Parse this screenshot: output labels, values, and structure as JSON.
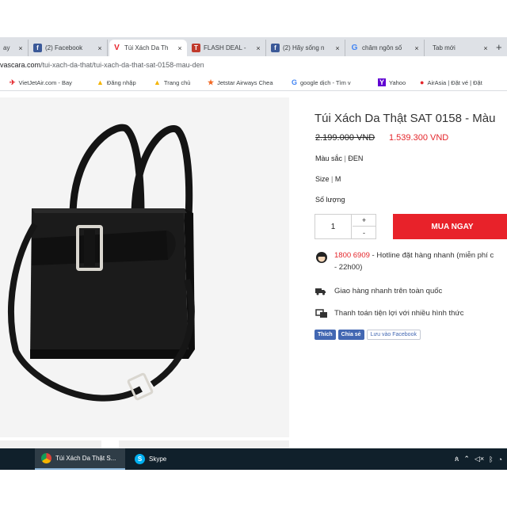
{
  "browser": {
    "tabs": [
      {
        "title": "ay",
        "icon": "page-icon",
        "active": false
      },
      {
        "title": "(2) Facebook",
        "icon": "facebook-icon",
        "active": false
      },
      {
        "title": "Túi Xách Da Th",
        "icon": "vascara-icon",
        "active": true
      },
      {
        "title": "FLASH DEAL -",
        "icon": "flash-deal-icon",
        "active": false
      },
      {
        "title": "(2) Hãy sống n",
        "icon": "facebook-icon",
        "active": false
      },
      {
        "title": "châm ngôn số",
        "icon": "google-icon",
        "active": false
      },
      {
        "title": "Tab mới",
        "icon": "",
        "active": false
      }
    ],
    "close_glyph": "×",
    "new_tab_glyph": "+",
    "url_host": "vascara.com",
    "url_path": "/tui-xach-da-that/tui-xach-da-that-sat-0158-mau-den",
    "bookmarks": [
      {
        "label": "VietJetAir.com - Bay",
        "icon": "vietjet-icon"
      },
      {
        "label": "Đăng nhập",
        "icon": "warning-icon"
      },
      {
        "label": "Trang chủ",
        "icon": "warning-icon"
      },
      {
        "label": "Jetstar Airways Chea",
        "icon": "jetstar-icon"
      },
      {
        "label": "google dịch - Tìm v",
        "icon": "google-icon"
      },
      {
        "label": "Yahoo",
        "icon": "yahoo-icon"
      },
      {
        "label": "AirAsia | Đặt vé | Đặt",
        "icon": "airasia-icon"
      }
    ]
  },
  "product": {
    "title": "Túi Xách Da Thật SAT 0158 - Màu",
    "old_price": "2.199.000 VND",
    "new_price": "1.539.300 VND",
    "color_label": "Màu sắc",
    "color_value": "ĐEN",
    "size_label": "Size",
    "size_value": "M",
    "separator": "|",
    "qty_label": "Số lượng",
    "qty_value": "1",
    "plus": "+",
    "minus": "-",
    "buy_label": "MUA NGAY",
    "hotline_number": "1800 6909",
    "hotline_text": " - Hotline đặt hàng nhanh (miễn phí c",
    "hotline_text2": "- 22h00)",
    "shipping_text": "Giao hàng nhanh trên toàn quốc",
    "payment_text": "Thanh toán tiện lợi với nhiều hình thức",
    "like_label": "Thích",
    "share_label": "Chia sẻ",
    "save_label": "Lưu vào Facebook"
  },
  "taskbar": {
    "chrome_task": "Túi Xách Da Thật S...",
    "skype_task": "Skype"
  },
  "colors": {
    "accent_red": "#e8222a",
    "price_red": "#e4262b",
    "facebook_blue": "#4267b2",
    "taskbar": "#10202b"
  }
}
